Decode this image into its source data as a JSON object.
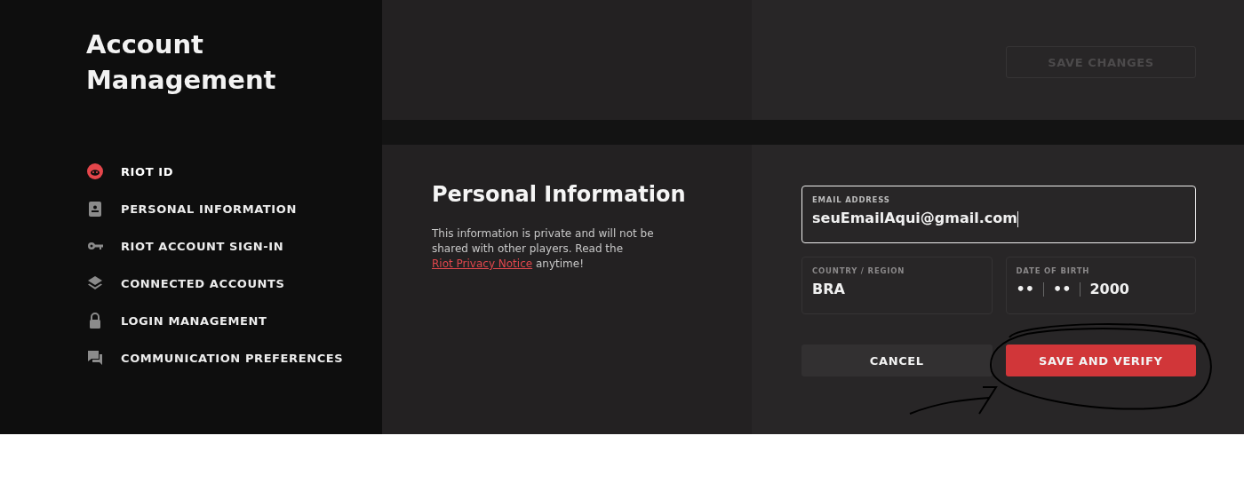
{
  "sidebar": {
    "title": "Account Management",
    "items": [
      {
        "label": "RIOT ID",
        "kind": "riot",
        "selected": true
      },
      {
        "label": "PERSONAL INFORMATION",
        "kind": "id",
        "selected": false
      },
      {
        "label": "RIOT ACCOUNT SIGN-IN",
        "kind": "key",
        "selected": false
      },
      {
        "label": "CONNECTED ACCOUNTS",
        "kind": "layers",
        "selected": false
      },
      {
        "label": "LOGIN MANAGEMENT",
        "kind": "lock",
        "selected": false
      },
      {
        "label": "COMMUNICATION PREFERENCES",
        "kind": "chat",
        "selected": false
      }
    ]
  },
  "header": {
    "save_button": {
      "label": "SAVE CHANGES",
      "disabled": true
    }
  },
  "section": {
    "title": "Personal Information",
    "description": "This information is private and will not be shared with other players. Read the ",
    "link": "Riot Privacy Notice",
    "description_end": " anytime!"
  },
  "form": {
    "email": {
      "label": "EMAIL ADDRESS",
      "value": "seuEmailAqui@gmail.com",
      "focused": true
    },
    "country": {
      "label": "COUNTRY / REGION",
      "value": "BRA"
    },
    "birth": {
      "label": "DATE OF BIRTH",
      "day": "••",
      "month": "••",
      "year": "2000"
    },
    "cancel": "CANCEL",
    "submit": "SAVE AND VERIFY"
  }
}
